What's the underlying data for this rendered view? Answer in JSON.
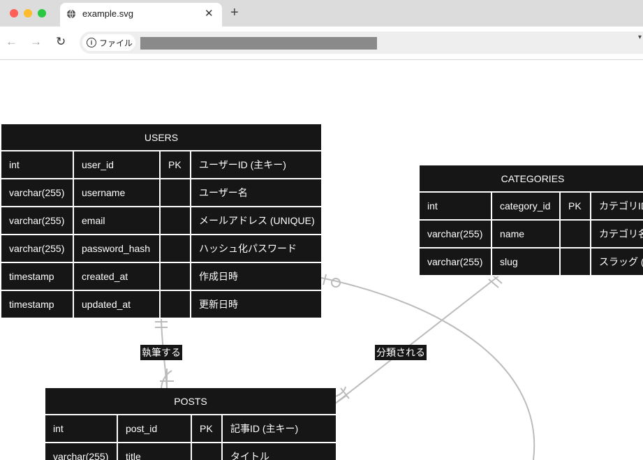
{
  "browser": {
    "tab_title": "example.svg",
    "new_tab": "+",
    "tab_close": "✕",
    "back": "←",
    "forward": "→",
    "reload": "↻",
    "info_chip": "ファイル",
    "more": "▾"
  },
  "diagram": {
    "line_color": "#bbbbbb",
    "table_bg": "#161616",
    "entities": {
      "users": {
        "name": "USERS",
        "rows": [
          [
            "int",
            "user_id",
            "PK",
            "ユーザーID (主キー)"
          ],
          [
            "varchar(255)",
            "username",
            "",
            "ユーザー名"
          ],
          [
            "varchar(255)",
            "email",
            "",
            "メールアドレス (UNIQUE)"
          ],
          [
            "varchar(255)",
            "password_hash",
            "",
            "ハッシュ化パスワード"
          ],
          [
            "timestamp",
            "created_at",
            "",
            "作成日時"
          ],
          [
            "timestamp",
            "updated_at",
            "",
            "更新日時"
          ]
        ]
      },
      "categories": {
        "name": "CATEGORIES",
        "rows": [
          [
            "int",
            "category_id",
            "PK",
            "カテゴリID"
          ],
          [
            "varchar(255)",
            "name",
            "",
            "カテゴリ名"
          ],
          [
            "varchar(255)",
            "slug",
            "",
            "スラッグ (U"
          ]
        ]
      },
      "posts": {
        "name": "POSTS",
        "rows": [
          [
            "int",
            "post_id",
            "PK",
            "記事ID (主キー)"
          ],
          [
            "varchar(255)",
            "title",
            "",
            "タイトル"
          ]
        ]
      }
    },
    "relationships": [
      {
        "from": "USERS",
        "to": "POSTS",
        "label": "執筆する"
      },
      {
        "from": "CATEGORIES",
        "to": "POSTS",
        "label": "分類される"
      },
      {
        "from": "USERS",
        "to": "",
        "label": ""
      }
    ]
  }
}
